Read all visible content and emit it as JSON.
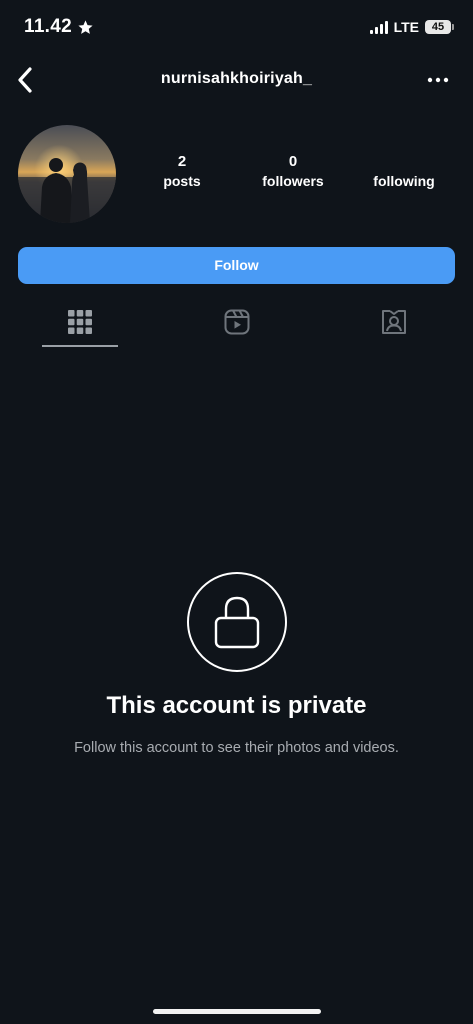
{
  "status_bar": {
    "time": "11.42",
    "network": "LTE",
    "battery": "45"
  },
  "header": {
    "username": "nurnisahkhoiriyah_",
    "back_icon": "chevron-left-icon",
    "more_icon": "more-horizontal-icon"
  },
  "profile": {
    "stats": {
      "posts_count": "2",
      "posts_label": "posts",
      "followers_count": "0",
      "followers_label": "followers",
      "following_count": "",
      "following_label": "following"
    },
    "follow_label": "Follow"
  },
  "tabs": [
    {
      "icon": "grid-icon",
      "active": true
    },
    {
      "icon": "reels-icon",
      "active": false
    },
    {
      "icon": "tagged-icon",
      "active": false
    }
  ],
  "private_notice": {
    "title": "This account is private",
    "subtitle": "Follow this account to see their photos and videos."
  },
  "colors": {
    "background": "#0f141a",
    "accent": "#4a9bf5",
    "muted_text": "#a8acb1"
  }
}
